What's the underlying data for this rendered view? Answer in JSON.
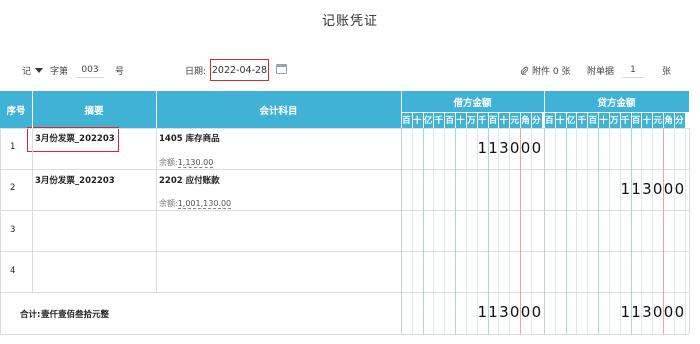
{
  "title": "记账凭证",
  "header": {
    "voucher_word": "记",
    "zi_label": "字第",
    "voucher_no": "003",
    "hao_label": "号",
    "date_label": "日期:",
    "date_value": "2022-04-28",
    "attachment": "附件 0 张",
    "attach_docs_label": "附单据",
    "attach_docs_value": "1",
    "zhang": "张"
  },
  "table": {
    "col_seq": "序号",
    "col_summary": "摘要",
    "col_account": "会计科目",
    "col_debit": "借方金额",
    "col_credit": "贷方金额",
    "digit_headers": [
      "百",
      "十",
      "亿",
      "千",
      "百",
      "十",
      "万",
      "千",
      "百",
      "十",
      "元",
      "角",
      "分"
    ],
    "rows": [
      {
        "seq": "1",
        "summary": "3月份发票_202203",
        "account": "1405 库存商品",
        "balance_label": "余额:",
        "balance": "1,130.00",
        "debit": "113000",
        "credit": ""
      },
      {
        "seq": "2",
        "summary": "3月份发票_202203",
        "account": "2202 应付账款",
        "balance_label": "余额:",
        "balance": "1,001,130.00",
        "debit": "",
        "credit": "113000"
      },
      {
        "seq": "3",
        "summary": "",
        "account": "",
        "balance_label": "",
        "balance": "",
        "debit": "",
        "credit": ""
      },
      {
        "seq": "4",
        "summary": "",
        "account": "",
        "balance_label": "",
        "balance": "",
        "debit": "",
        "credit": ""
      }
    ],
    "total_label": "合计:",
    "total_words": "壹仟壹佰叁拾元整",
    "total_debit": "113000",
    "total_credit": "113000"
  },
  "colors": {
    "header_bg": "#3fb2d6",
    "highlight": "#d9272e",
    "grid_line": "#d9dde3"
  }
}
